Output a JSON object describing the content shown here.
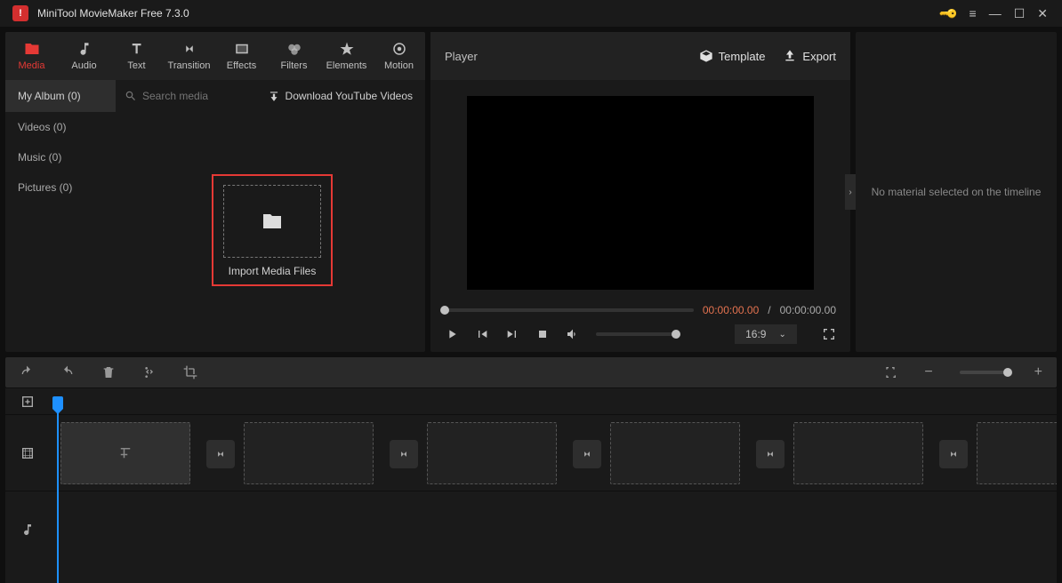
{
  "title": "MiniTool MovieMaker Free 7.3.0",
  "tabs": {
    "media": "Media",
    "audio": "Audio",
    "text": "Text",
    "transition": "Transition",
    "effects": "Effects",
    "filters": "Filters",
    "elements": "Elements",
    "motion": "Motion"
  },
  "sidebar": {
    "album": "My Album (0)",
    "cats": {
      "videos": "Videos (0)",
      "music": "Music (0)",
      "pictures": "Pictures (0)"
    }
  },
  "search_placeholder": "Search media",
  "download_label": "Download YouTube Videos",
  "import_label": "Import Media Files",
  "player": {
    "title": "Player",
    "template": "Template",
    "export": "Export",
    "time_current": "00:00:00.00",
    "time_sep": " / ",
    "time_total": "00:00:00.00",
    "ratio": "16:9"
  },
  "right_panel": "No material selected on the timeline"
}
